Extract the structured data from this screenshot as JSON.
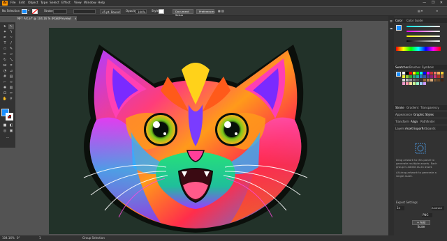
{
  "app": {
    "logo": "Ai"
  },
  "menu": [
    "File",
    "Edit",
    "Object",
    "Type",
    "Select",
    "Effect",
    "View",
    "Window",
    "Help"
  ],
  "window_controls": "— ❐ ✕",
  "control_bar": {
    "selection_label": "No Selection",
    "stroke_label": "Stroke:",
    "brush_label": "5 pt. Round",
    "opacity_label": "Opacity:",
    "opacity_value": "100%",
    "style_label": "Style:",
    "doc_setup_button": "Document Setup",
    "preferences_button": "Preferences"
  },
  "document_tab": {
    "title": "NFT Art.ai* @ 104.16 % (RGB/Preview)",
    "close": "×"
  },
  "status_bar": {
    "zoom": "104.16%",
    "rotation": "0°",
    "page": "1",
    "tool": "Group Selection"
  },
  "panels": {
    "color_tabs": [
      "Color",
      "Color Guide"
    ],
    "swatch_tabs": [
      "Swatches",
      "Brushes",
      "Symbols"
    ],
    "stroke_tabs": [
      "Stroke",
      "Gradient",
      "Transparency"
    ],
    "appearance_tabs": [
      "Appearance",
      "Graphic Styles"
    ],
    "transform_tabs": [
      "Transform",
      "Align",
      "Pathfinder"
    ],
    "layers_tabs": [
      "Layers",
      "Asset Export",
      "Artboards"
    ],
    "asset_export_text_1": "Drag artwork to this panel to generate multiple assets. Each group is added as an asset.",
    "asset_export_text_2": "Alt-drag artwork to generate a single asset.",
    "export_settings_label": "Export Settings",
    "scale_value": "1x",
    "suffix_label": "Android",
    "format_value": "PNG",
    "add_scale_button": "+ Add Scale"
  },
  "colors": {
    "fill": "#1a8fff",
    "artboard": "#223229",
    "accent": "#ff9a00"
  }
}
